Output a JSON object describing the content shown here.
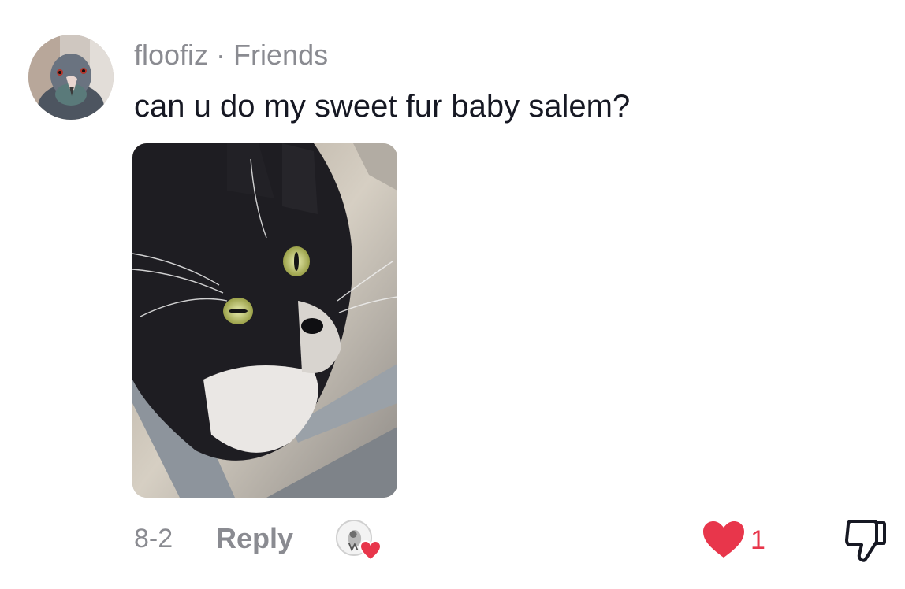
{
  "comment": {
    "username": "floofiz",
    "separator": "·",
    "relationship": "Friends",
    "text": "can u do my sweet fur baby salem?",
    "date": "8-2",
    "reply_label": "Reply",
    "like_count": "1",
    "liked": true
  },
  "icons": {
    "avatar": "pigeon-avatar",
    "like": "heart-icon",
    "dislike": "thumbs-down-icon",
    "creator_liked": "creator-liked-heart-icon"
  },
  "colors": {
    "like_red": "#e8364b",
    "secondary_text": "#8a8b91",
    "primary_text": "#161823"
  }
}
